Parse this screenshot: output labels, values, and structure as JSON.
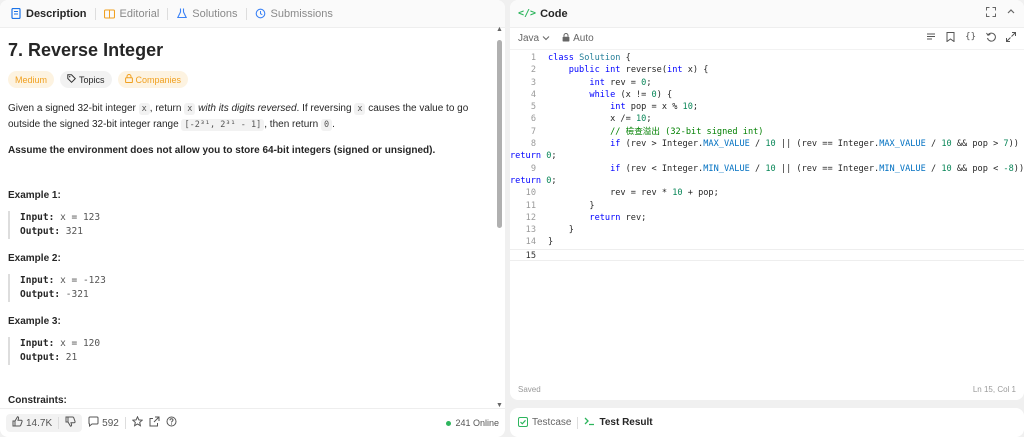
{
  "left_tabs": {
    "description": "Description",
    "editorial": "Editorial",
    "solutions": "Solutions",
    "submissions": "Submissions"
  },
  "problem": {
    "title": "7. Reverse Integer",
    "difficulty": "Medium",
    "topics": "Topics",
    "companies": "Companies",
    "desc_1": "Given a signed 32-bit integer",
    "desc_x1": "x",
    "desc_2": ", return",
    "desc_x2": "x",
    "desc_italic": "with its digits reversed",
    "desc_3": ". If reversing",
    "desc_x3": "x",
    "desc_4": "causes the value to go outside the signed 32-bit integer range",
    "desc_range": "[-2³¹, 2³¹ - 1]",
    "desc_5": ", then return",
    "desc_zero": "0",
    "desc_6": ".",
    "note": "Assume the environment does not allow you to store 64-bit integers (signed or unsigned).",
    "examples": [
      {
        "title": "Example 1:",
        "input_label": "Input:",
        "input": "x = 123",
        "output_label": "Output:",
        "output": "321"
      },
      {
        "title": "Example 2:",
        "input_label": "Input:",
        "input": "x = -123",
        "output_label": "Output:",
        "output": "-321"
      },
      {
        "title": "Example 3:",
        "input_label": "Input:",
        "input": "x = 120",
        "output_label": "Output:",
        "output": "21"
      }
    ],
    "constraints_title": "Constraints:"
  },
  "footer": {
    "likes": "14.7K",
    "comments": "592",
    "online": "241 Online"
  },
  "code_panel": {
    "title": "Code",
    "language": "Java",
    "mode": "Auto",
    "status_saved": "Saved",
    "cursor_pos": "Ln 15, Col 1"
  },
  "code_lines": [
    {
      "n": "1",
      "t": "class Solution {"
    },
    {
      "n": "2",
      "t": "    public int reverse(int x) {"
    },
    {
      "n": "3",
      "t": "        int rev = 0;"
    },
    {
      "n": "4",
      "t": "        while (x != 0) {"
    },
    {
      "n": "5",
      "t": "            int pop = x % 10;"
    },
    {
      "n": "6",
      "t": "            x /= 10;"
    },
    {
      "n": "7",
      "t": "            // 檢查溢出 (32-bit signed int)"
    },
    {
      "n": "8",
      "t": "            if (rev > Integer.MAX_VALUE / 10 || (rev == Integer.MAX_VALUE / 10 && pop > 7))"
    },
    {
      "n": "",
      "t": "return 0;"
    },
    {
      "n": "9",
      "t": "            if (rev < Integer.MIN_VALUE / 10 || (rev == Integer.MIN_VALUE / 10 && pop < -8))"
    },
    {
      "n": "",
      "t": "return 0;"
    },
    {
      "n": "10",
      "t": "            rev = rev * 10 + pop;"
    },
    {
      "n": "11",
      "t": "        }"
    },
    {
      "n": "12",
      "t": "        return rev;"
    },
    {
      "n": "13",
      "t": "    }"
    },
    {
      "n": "14",
      "t": "}"
    },
    {
      "n": "15",
      "t": ""
    }
  ],
  "result_tabs": {
    "testcase": "Testcase",
    "test_result": "Test Result"
  },
  "colors": {
    "accent_green": "#2db55d",
    "difficulty_orange": "#f0a020",
    "keyword_blue": "#0000ff",
    "comment_green": "#008000"
  }
}
